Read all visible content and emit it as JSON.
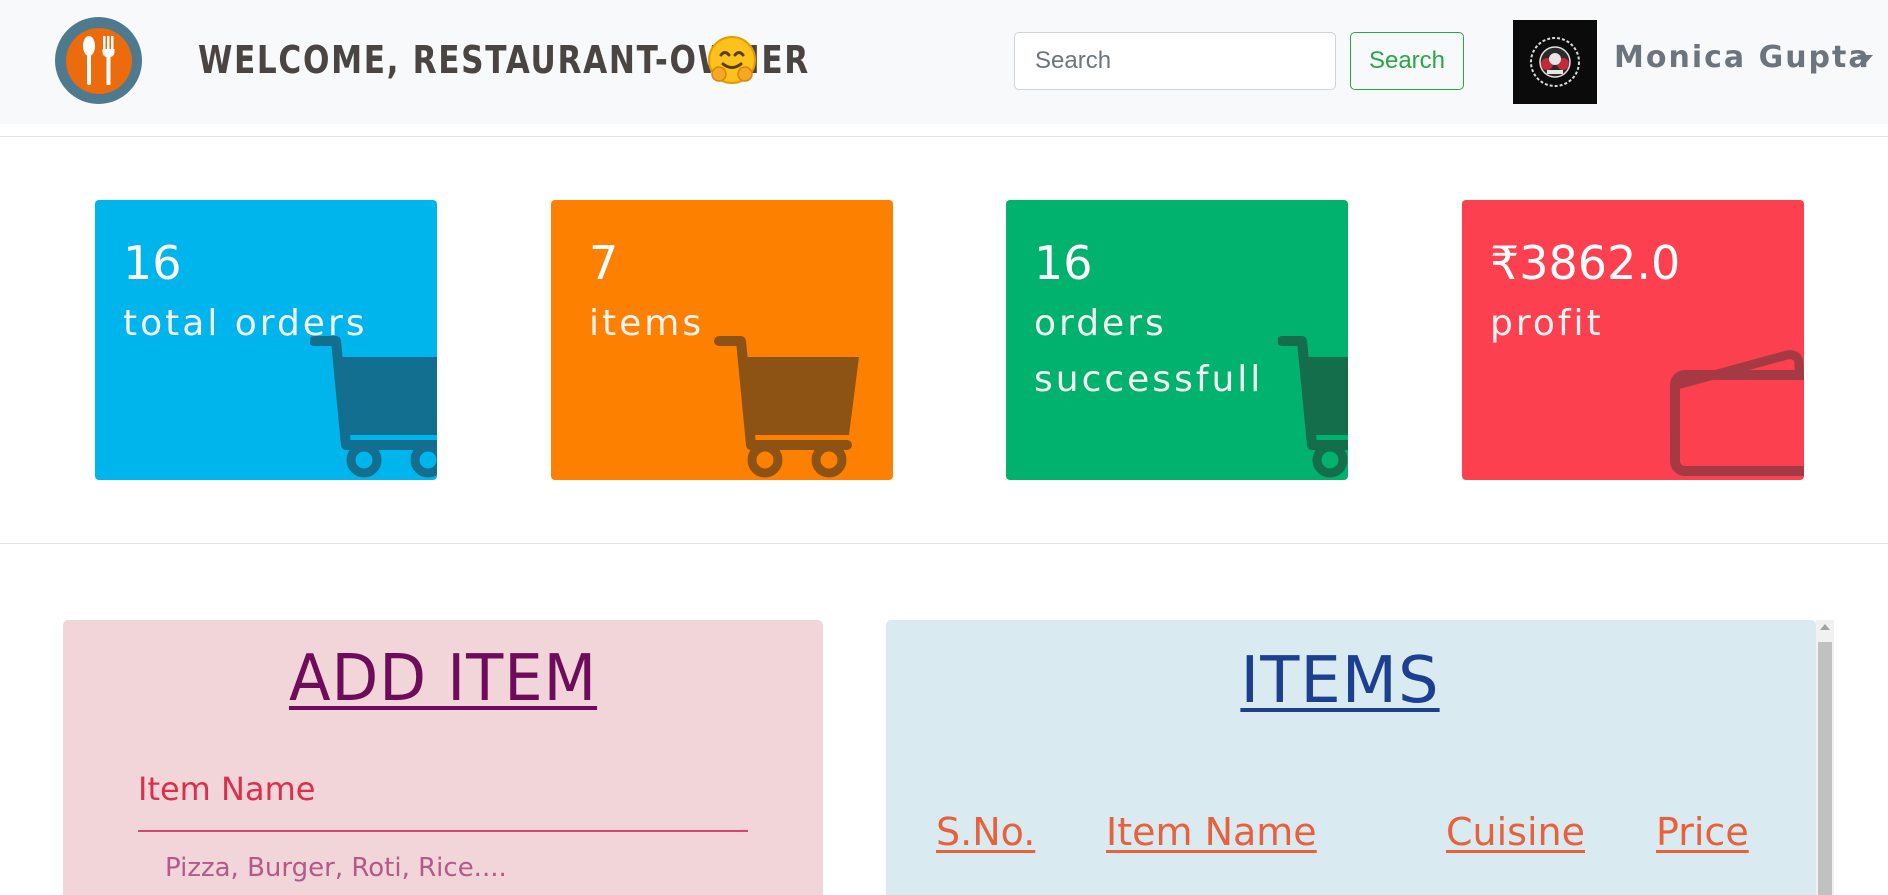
{
  "header": {
    "welcome_text": "WELCOME, RESTAURANT-OWNER",
    "search_placeholder": "Search",
    "search_button_label": "Search",
    "user_name": "Monica Gupta"
  },
  "stats": [
    {
      "value": "16",
      "label": "total orders",
      "color": "#00b4ec",
      "icon": "shopping-cart-icon"
    },
    {
      "value": "7",
      "label": "items",
      "color": "#fe8000",
      "icon": "shopping-cart-icon"
    },
    {
      "value": "16",
      "label": "orders successfull",
      "color": "#00b26e",
      "icon": "shopping-cart-icon"
    },
    {
      "value": "₹3862.0",
      "label": "profit",
      "color": "#fd404f",
      "icon": "wallet-icon"
    }
  ],
  "add_item": {
    "title": "ADD ITEM",
    "item_name_label": "Item Name",
    "item_name_placeholder": "Pizza, Burger, Roti, Rice...."
  },
  "items_table": {
    "title": "ITEMS",
    "columns": [
      "S.No.",
      "Item Name",
      "Cuisine",
      "Price"
    ]
  }
}
